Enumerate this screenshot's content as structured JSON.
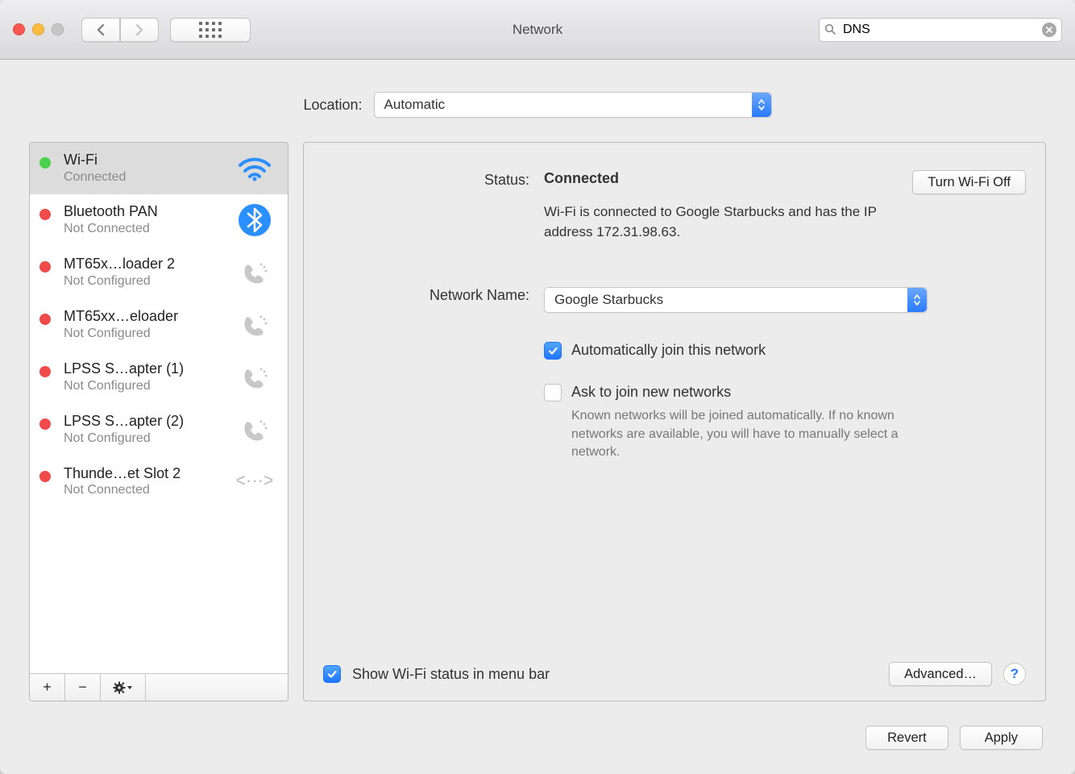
{
  "window": {
    "title": "Network"
  },
  "toolbar": {
    "search_value": "DNS"
  },
  "location": {
    "label": "Location:",
    "value": "Automatic"
  },
  "sidebar": {
    "items": [
      {
        "name": "Wi-Fi",
        "status": "Connected",
        "dot": "green",
        "icon": "wifi",
        "selected": true
      },
      {
        "name": "Bluetooth PAN",
        "status": "Not Connected",
        "dot": "red",
        "icon": "bluetooth"
      },
      {
        "name": "MT65x…loader 2",
        "status": "Not Configured",
        "dot": "red",
        "icon": "phone"
      },
      {
        "name": "MT65xx…eloader",
        "status": "Not Configured",
        "dot": "red",
        "icon": "phone"
      },
      {
        "name": "LPSS S…apter (1)",
        "status": "Not Configured",
        "dot": "red",
        "icon": "phone"
      },
      {
        "name": "LPSS S…apter (2)",
        "status": "Not Configured",
        "dot": "red",
        "icon": "phone"
      },
      {
        "name": "Thunde…et Slot 2",
        "status": "Not Connected",
        "dot": "red",
        "icon": "ethernet"
      }
    ]
  },
  "main": {
    "status_label": "Status:",
    "status_value": "Connected",
    "wifi_off_btn": "Turn Wi-Fi Off",
    "status_desc": "Wi-Fi is connected to Google Starbucks and has the IP address 172.31.98.63.",
    "network_label": "Network Name:",
    "network_value": "Google Starbucks",
    "auto_join": "Automatically join this network",
    "ask_join": "Ask to join new networks",
    "ask_note": "Known networks will be joined automatically. If no known networks are available, you will have to manually select a network.",
    "menubar": "Show Wi-Fi status in menu bar",
    "advanced": "Advanced…"
  },
  "footer": {
    "revert": "Revert",
    "apply": "Apply"
  }
}
